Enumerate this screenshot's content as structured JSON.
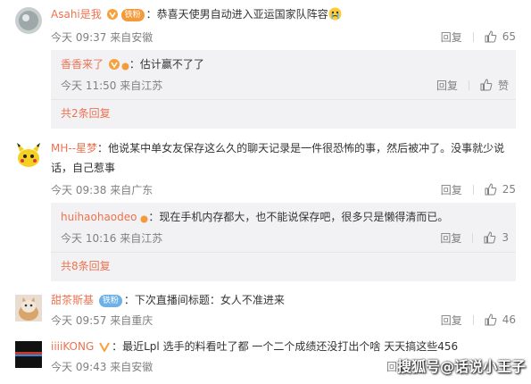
{
  "comments": [
    {
      "user": "Asahi是我",
      "fan_badge": "铁粉",
      "text": "恭喜天使男自动进入亚运国家队阵容",
      "time": "今天 09:37 来自安徽",
      "reply": "回复",
      "likes": "65",
      "replies": [
        {
          "user": "香香来了",
          "text": "估计赢不了了",
          "time": "今天 11:50 来自江苏",
          "reply": "回复",
          "likes": "赞"
        }
      ],
      "more": "共2条回复"
    },
    {
      "user": "MH--星梦",
      "text_line1": "他说某中单女友保存这么久的聊天记录是一件很恐怖的事，然后被冲了。没事就少说",
      "text_line2": "话，自己惹事",
      "time": "今天 09:38 来自广东",
      "reply": "回复",
      "likes": "25",
      "replies": [
        {
          "user": "huihaohaodeo",
          "text": "现在手机内存都大，也不能说保存吧，很多只是懒得清而已。",
          "time": "今天 10:16 来自江苏",
          "reply": "回复",
          "likes": "3"
        }
      ],
      "more": "共8条回复"
    },
    {
      "user": "甜茶斯基",
      "fan_badge": "铁粉",
      "text": "下次直播间标题：女人不准进来",
      "time": "今天 09:57 来自重庆",
      "reply": "回复",
      "likes": "46"
    },
    {
      "user": "iiiiKONG",
      "text": "最近Lpl 选手的料看吐了都 一个二个成绩还没打出个啥 天天搞这些456",
      "time": "今天 09:43 来自安徽",
      "reply": "回复"
    }
  ],
  "watermark": "搜狐号@话说小王子",
  "colors": {
    "username": "#eb7350",
    "meta": "#808080",
    "subbox_bg": "#f2f2f5"
  }
}
